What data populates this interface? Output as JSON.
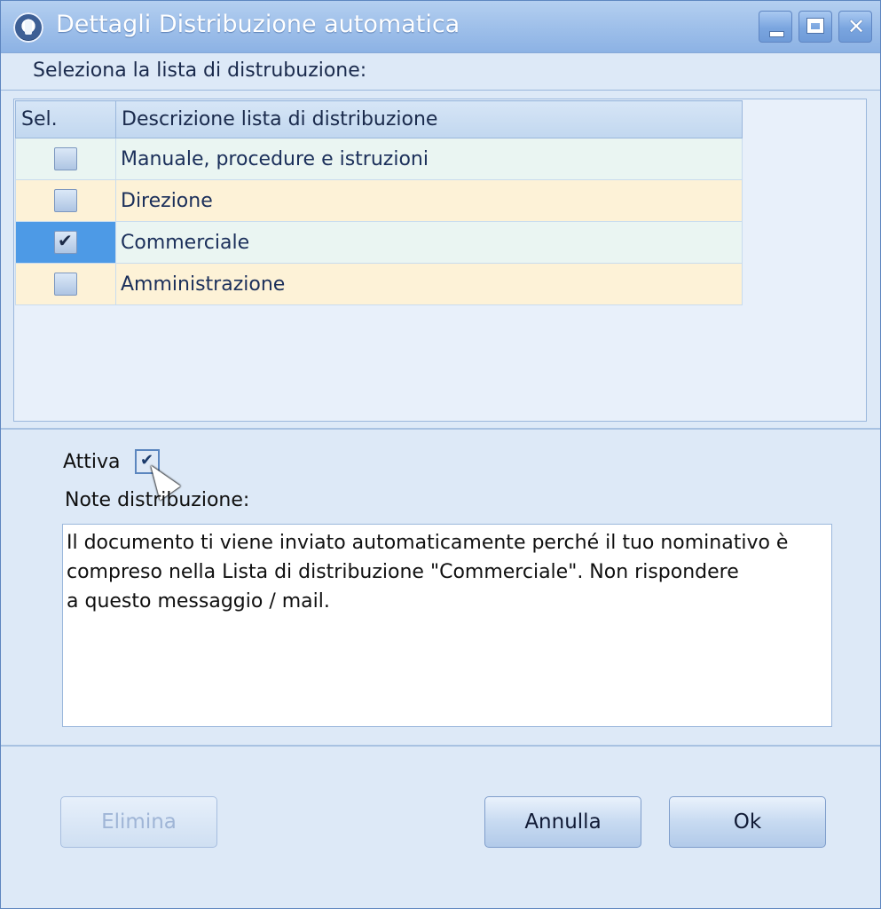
{
  "window": {
    "title": "Dettagli Distribuzione automatica",
    "icon": "app-logo-icon",
    "controls": [
      "minimize-icon",
      "maximize-icon",
      "close-icon"
    ],
    "close_glyph": "✕"
  },
  "list_section": {
    "label": "Seleziona la lista di distrubuzione:",
    "columns": [
      "Sel.",
      "Descrizione lista di distribuzione"
    ],
    "rows": [
      {
        "selected": false,
        "description": "Manuale, procedure e istruzioni"
      },
      {
        "selected": false,
        "description": "Direzione"
      },
      {
        "selected": true,
        "description": "Commerciale"
      },
      {
        "selected": false,
        "description": "Amministrazione"
      }
    ]
  },
  "details": {
    "attiva_label": "Attiva",
    "attiva_checked": true,
    "notes_label": "Note distribuzione:",
    "notes_text": "Il documento ti viene inviato automaticamente perché il tuo nominativo è\ncompreso nella Lista di distribuzione \"Commerciale\". Non rispondere\na questo messaggio / mail."
  },
  "buttons": {
    "elimina": "Elimina",
    "annulla": "Annulla",
    "ok": "Ok"
  },
  "colors": {
    "titlebar": "#9fc0ea",
    "window_bg": "#dde9f7",
    "row_alt_1": "#eaf5f2",
    "row_alt_2": "#fdf2d7",
    "selection": "#4d9ae6"
  }
}
